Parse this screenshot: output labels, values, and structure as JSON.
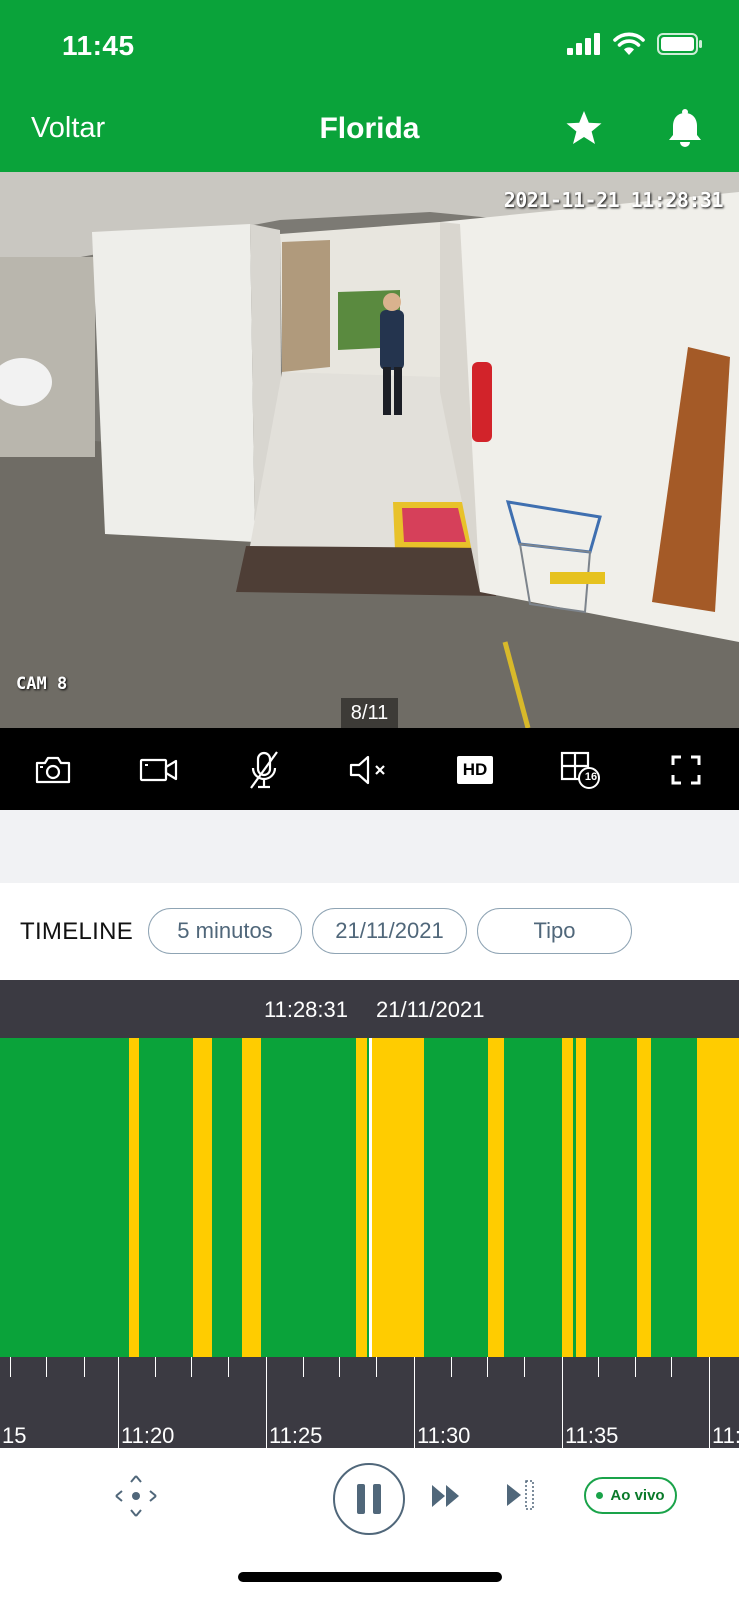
{
  "status_bar": {
    "time": "11:45"
  },
  "nav": {
    "back_label": "Voltar",
    "title": "Florida"
  },
  "camera": {
    "timestamp": "2021-11-21  11:28:31",
    "camera_label": "CAM 8",
    "page_indicator": "8/11"
  },
  "toolbar": {
    "buttons": [
      "camera-icon",
      "video-record-icon",
      "mic-muted-icon",
      "speaker-muted-icon",
      "hd-icon",
      "grid-16-icon",
      "fullscreen-icon"
    ],
    "hd_label": "HD",
    "grid_badge": "16"
  },
  "timeline": {
    "label": "TIMELINE",
    "filters": {
      "interval": "5 minutos",
      "date": "21/11/2021",
      "type": "Tipo"
    },
    "current_time": "11:28:31",
    "current_date": "21/11/2021",
    "tick_labels": [
      "15",
      "11:20",
      "11:25",
      "11:30",
      "11:35",
      "11:"
    ],
    "colors": {
      "continuous": "#0aa33a",
      "motion": "#ffcc00"
    }
  },
  "controls": {
    "icons": [
      "move-arrows-icon",
      "pause-icon",
      "fast-forward-icon",
      "skip-to-end-icon"
    ],
    "live_label": "Ao vivo"
  }
}
